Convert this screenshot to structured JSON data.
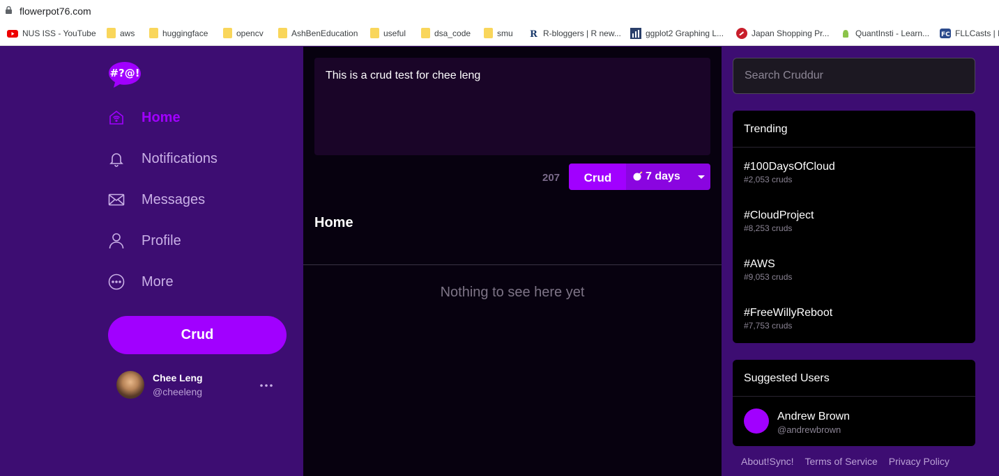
{
  "browser": {
    "url": "flowerpot76.com",
    "bookmarks": [
      {
        "label": "NUS ISS - YouTube",
        "icon": "youtube-icon"
      },
      {
        "label": "aws",
        "icon": "folder-icon"
      },
      {
        "label": "huggingface",
        "icon": "folder-icon"
      },
      {
        "label": "opencv",
        "icon": "folder-icon"
      },
      {
        "label": "AshBenEducation",
        "icon": "folder-icon"
      },
      {
        "label": "useful",
        "icon": "folder-icon"
      },
      {
        "label": "dsa_code",
        "icon": "folder-icon"
      },
      {
        "label": "smu",
        "icon": "folder-icon"
      },
      {
        "label": "R-bloggers | R new...",
        "icon": "rbloggers-icon"
      },
      {
        "label": "ggplot2 Graphing L...",
        "icon": "ggplot-icon"
      },
      {
        "label": "Japan Shopping Pr...",
        "icon": "japan-shop-icon"
      },
      {
        "label": "QuantInsti - Learn...",
        "icon": "android-icon"
      },
      {
        "label": "FLLCasts | B",
        "icon": "fllcasts-icon"
      }
    ]
  },
  "sidebar": {
    "logo_text": "#?@!",
    "nav": [
      {
        "label": "Home",
        "icon": "home-icon",
        "active": true
      },
      {
        "label": "Notifications",
        "icon": "bell-icon"
      },
      {
        "label": "Messages",
        "icon": "envelope-icon"
      },
      {
        "label": "Profile",
        "icon": "person-icon"
      },
      {
        "label": "More",
        "icon": "more-circle-icon"
      }
    ],
    "crud_label": "Crud",
    "user": {
      "name": "Chee Leng",
      "handle": "@cheeleng",
      "more": "..."
    }
  },
  "main": {
    "compose_text": "This is a crud test for chee leng",
    "char_count": "207",
    "post_label": "Crud",
    "ttl_label": "7 days",
    "ttl_icon": "bomb-icon",
    "title": "Home",
    "empty_text": "Nothing to see here yet"
  },
  "rightbar": {
    "search_placeholder": "Search Cruddur",
    "trending_title": "Trending",
    "trends": [
      {
        "name": "#100DaysOfCloud",
        "count": "#2,053 cruds"
      },
      {
        "name": "#CloudProject",
        "count": "#8,253 cruds"
      },
      {
        "name": "#AWS",
        "count": "#9,053 cruds"
      },
      {
        "name": "#FreeWillyReboot",
        "count": "#7,753 cruds"
      }
    ],
    "suggested_title": "Suggested Users",
    "suggested": [
      {
        "name": "Andrew Brown",
        "handle": "@andrewbrown"
      }
    ],
    "footer": [
      "About!Sync!",
      "Terms of Service",
      "Privacy Policy"
    ]
  },
  "colors": {
    "accent": "#a100ff",
    "sidebar_bg": "#3d0d72",
    "feed_bg": "#07010f"
  }
}
